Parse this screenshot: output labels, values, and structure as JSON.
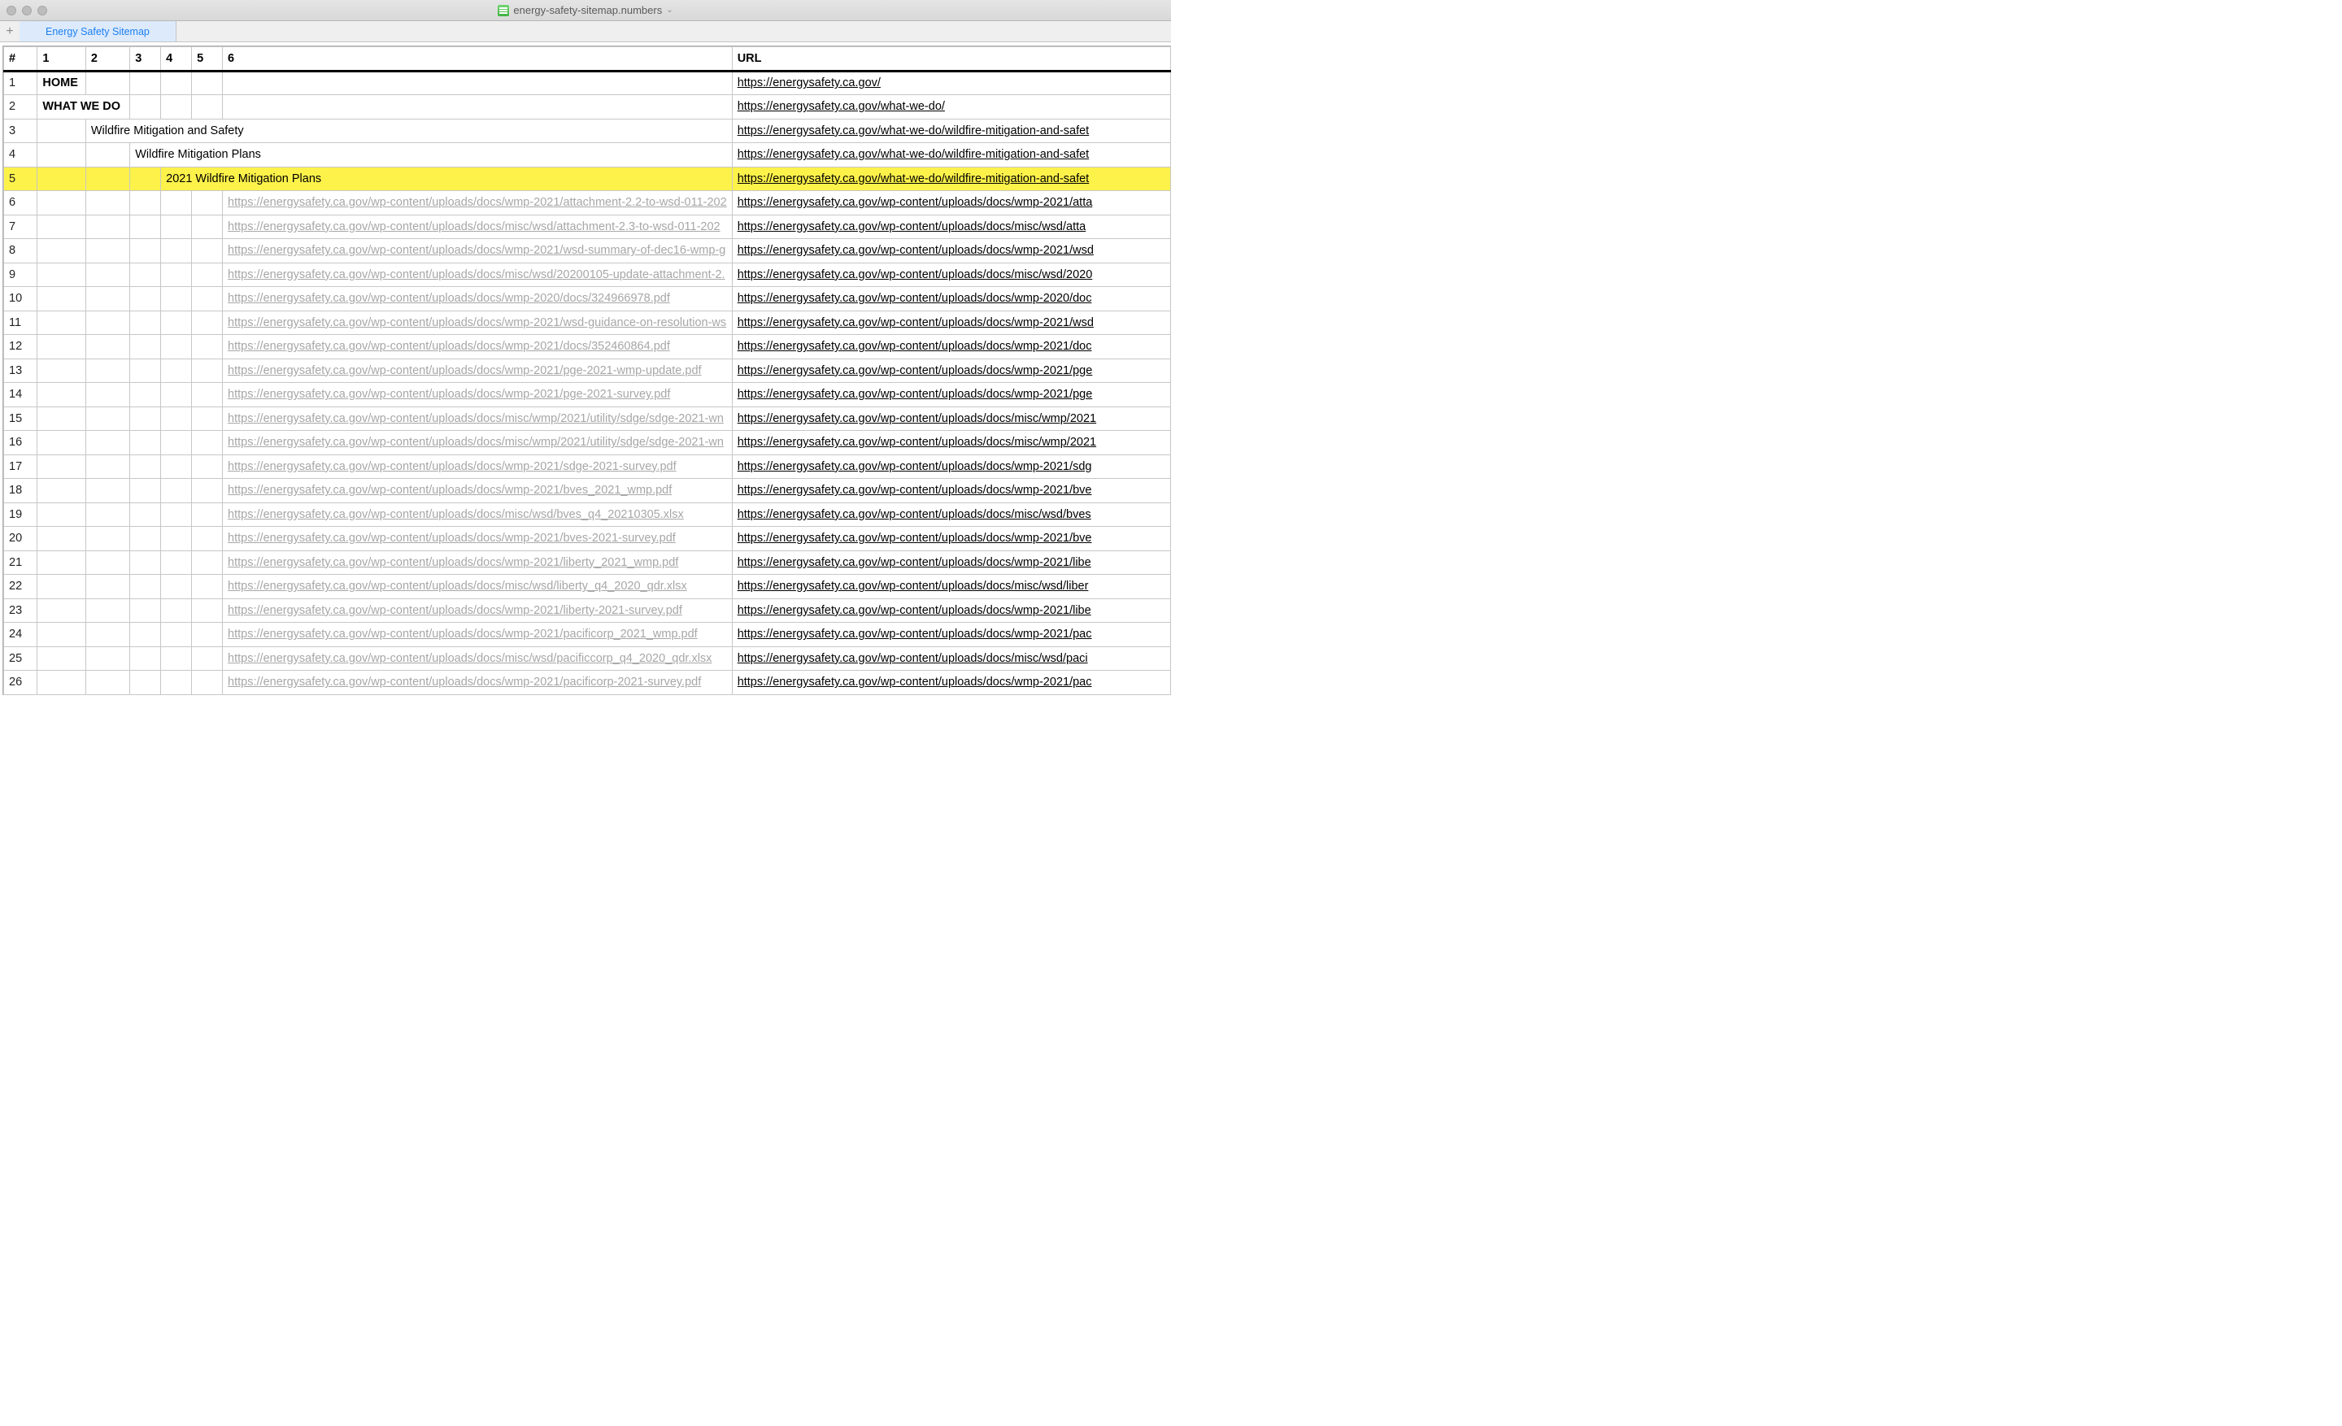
{
  "window": {
    "filename": "energy-safety-sitemap.numbers"
  },
  "tabs": {
    "add": "+",
    "sheet": "Energy Safety Sitemap"
  },
  "headers": [
    "#",
    "1",
    "2",
    "3",
    "4",
    "5",
    "6",
    "URL"
  ],
  "rows": [
    {
      "n": "1",
      "c1": "HOME",
      "c2": "",
      "c3": "",
      "c4": "",
      "c5": "",
      "c6": "",
      "url": "https://energysafety.ca.gov/",
      "bold": true,
      "c6link": false
    },
    {
      "n": "2",
      "c1": "WHAT WE DO",
      "c2": "",
      "c3": "",
      "c4": "",
      "c5": "",
      "c6": "",
      "url": "https://energysafety.ca.gov/what-we-do/",
      "bold": true,
      "c1colspan": 2,
      "c6link": false
    },
    {
      "n": "3",
      "c1": "",
      "c2": "Wildfire Mitigation and Safety",
      "c3": "",
      "c4": "",
      "c5": "",
      "c6": "",
      "url": "https://energysafety.ca.gov/what-we-do/wildfire-mitigation-and-safet",
      "c2colspan": 5,
      "c6link": false
    },
    {
      "n": "4",
      "c1": "",
      "c2": "",
      "c3": "Wildfire Mitigation Plans",
      "c4": "",
      "c5": "",
      "c6": "",
      "url": "https://energysafety.ca.gov/what-we-do/wildfire-mitigation-and-safet",
      "c3colspan": 4,
      "c6link": false
    },
    {
      "n": "5",
      "c1": "",
      "c2": "",
      "c3": "",
      "c4": "2021 Wildfire Mitigation Plans",
      "c5": "",
      "c6": "",
      "url": "https://energysafety.ca.gov/what-we-do/wildfire-mitigation-and-safet",
      "highlight": true,
      "c4colspan": 3,
      "c6link": false
    },
    {
      "n": "6",
      "c1": "",
      "c2": "",
      "c3": "",
      "c4": "",
      "c5": "",
      "c6": "https://energysafety.ca.gov/wp-content/uploads/docs/wmp-2021/attachment-2.2-to-wsd-011-202",
      "url": "https://energysafety.ca.gov/wp-content/uploads/docs/wmp-2021/atta",
      "c6link": true
    },
    {
      "n": "7",
      "c1": "",
      "c2": "",
      "c3": "",
      "c4": "",
      "c5": "",
      "c6": "https://energysafety.ca.gov/wp-content/uploads/docs/misc/wsd/attachment-2.3-to-wsd-011-202",
      "url": "https://energysafety.ca.gov/wp-content/uploads/docs/misc/wsd/atta",
      "c6link": true
    },
    {
      "n": "8",
      "c1": "",
      "c2": "",
      "c3": "",
      "c4": "",
      "c5": "",
      "c6": "https://energysafety.ca.gov/wp-content/uploads/docs/wmp-2021/wsd-summary-of-dec16-wmp-g",
      "url": "https://energysafety.ca.gov/wp-content/uploads/docs/wmp-2021/wsd",
      "c6link": true
    },
    {
      "n": "9",
      "c1": "",
      "c2": "",
      "c3": "",
      "c4": "",
      "c5": "",
      "c6": "https://energysafety.ca.gov/wp-content/uploads/docs/misc/wsd/20200105-update-attachment-2.",
      "url": "https://energysafety.ca.gov/wp-content/uploads/docs/misc/wsd/2020",
      "c6link": true
    },
    {
      "n": "10",
      "c1": "",
      "c2": "",
      "c3": "",
      "c4": "",
      "c5": "",
      "c6": "https://energysafety.ca.gov/wp-content/uploads/docs/wmp-2020/docs/324966978.pdf",
      "url": "https://energysafety.ca.gov/wp-content/uploads/docs/wmp-2020/doc",
      "c6link": true
    },
    {
      "n": "11",
      "c1": "",
      "c2": "",
      "c3": "",
      "c4": "",
      "c5": "",
      "c6": "https://energysafety.ca.gov/wp-content/uploads/docs/wmp-2021/wsd-guidance-on-resolution-ws",
      "url": "https://energysafety.ca.gov/wp-content/uploads/docs/wmp-2021/wsd",
      "c6link": true
    },
    {
      "n": "12",
      "c1": "",
      "c2": "",
      "c3": "",
      "c4": "",
      "c5": "",
      "c6": "https://energysafety.ca.gov/wp-content/uploads/docs/wmp-2021/docs/352460864.pdf",
      "url": "https://energysafety.ca.gov/wp-content/uploads/docs/wmp-2021/doc",
      "c6link": true
    },
    {
      "n": "13",
      "c1": "",
      "c2": "",
      "c3": "",
      "c4": "",
      "c5": "",
      "c6": "https://energysafety.ca.gov/wp-content/uploads/docs/wmp-2021/pge-2021-wmp-update.pdf",
      "url": "https://energysafety.ca.gov/wp-content/uploads/docs/wmp-2021/pge",
      "c6link": true
    },
    {
      "n": "14",
      "c1": "",
      "c2": "",
      "c3": "",
      "c4": "",
      "c5": "",
      "c6": "https://energysafety.ca.gov/wp-content/uploads/docs/wmp-2021/pge-2021-survey.pdf",
      "url": "https://energysafety.ca.gov/wp-content/uploads/docs/wmp-2021/pge",
      "c6link": true
    },
    {
      "n": "15",
      "c1": "",
      "c2": "",
      "c3": "",
      "c4": "",
      "c5": "",
      "c6": "https://energysafety.ca.gov/wp-content/uploads/docs/misc/wmp/2021/utility/sdge/sdge-2021-wn",
      "url": "https://energysafety.ca.gov/wp-content/uploads/docs/misc/wmp/2021",
      "c6link": true
    },
    {
      "n": "16",
      "c1": "",
      "c2": "",
      "c3": "",
      "c4": "",
      "c5": "",
      "c6": "https://energysafety.ca.gov/wp-content/uploads/docs/misc/wmp/2021/utility/sdge/sdge-2021-wn",
      "url": "https://energysafety.ca.gov/wp-content/uploads/docs/misc/wmp/2021",
      "c6link": true
    },
    {
      "n": "17",
      "c1": "",
      "c2": "",
      "c3": "",
      "c4": "",
      "c5": "",
      "c6": "https://energysafety.ca.gov/wp-content/uploads/docs/wmp-2021/sdge-2021-survey.pdf",
      "url": "https://energysafety.ca.gov/wp-content/uploads/docs/wmp-2021/sdg",
      "c6link": true
    },
    {
      "n": "18",
      "c1": "",
      "c2": "",
      "c3": "",
      "c4": "",
      "c5": "",
      "c6": "https://energysafety.ca.gov/wp-content/uploads/docs/wmp-2021/bves_2021_wmp.pdf",
      "url": "https://energysafety.ca.gov/wp-content/uploads/docs/wmp-2021/bve",
      "c6link": true
    },
    {
      "n": "19",
      "c1": "",
      "c2": "",
      "c3": "",
      "c4": "",
      "c5": "",
      "c6": "https://energysafety.ca.gov/wp-content/uploads/docs/misc/wsd/bves_q4_20210305.xlsx",
      "url": "https://energysafety.ca.gov/wp-content/uploads/docs/misc/wsd/bves",
      "c6link": true
    },
    {
      "n": "20",
      "c1": "",
      "c2": "",
      "c3": "",
      "c4": "",
      "c5": "",
      "c6": "https://energysafety.ca.gov/wp-content/uploads/docs/wmp-2021/bves-2021-survey.pdf",
      "url": "https://energysafety.ca.gov/wp-content/uploads/docs/wmp-2021/bve",
      "c6link": true
    },
    {
      "n": "21",
      "c1": "",
      "c2": "",
      "c3": "",
      "c4": "",
      "c5": "",
      "c6": "https://energysafety.ca.gov/wp-content/uploads/docs/wmp-2021/liberty_2021_wmp.pdf",
      "url": "https://energysafety.ca.gov/wp-content/uploads/docs/wmp-2021/libe",
      "c6link": true
    },
    {
      "n": "22",
      "c1": "",
      "c2": "",
      "c3": "",
      "c4": "",
      "c5": "",
      "c6": "https://energysafety.ca.gov/wp-content/uploads/docs/misc/wsd/liberty_q4_2020_qdr.xlsx",
      "url": "https://energysafety.ca.gov/wp-content/uploads/docs/misc/wsd/liber",
      "c6link": true
    },
    {
      "n": "23",
      "c1": "",
      "c2": "",
      "c3": "",
      "c4": "",
      "c5": "",
      "c6": "https://energysafety.ca.gov/wp-content/uploads/docs/wmp-2021/liberty-2021-survey.pdf",
      "url": "https://energysafety.ca.gov/wp-content/uploads/docs/wmp-2021/libe",
      "c6link": true
    },
    {
      "n": "24",
      "c1": "",
      "c2": "",
      "c3": "",
      "c4": "",
      "c5": "",
      "c6": "https://energysafety.ca.gov/wp-content/uploads/docs/wmp-2021/pacificorp_2021_wmp.pdf",
      "url": "https://energysafety.ca.gov/wp-content/uploads/docs/wmp-2021/pac",
      "c6link": true
    },
    {
      "n": "25",
      "c1": "",
      "c2": "",
      "c3": "",
      "c4": "",
      "c5": "",
      "c6": "https://energysafety.ca.gov/wp-content/uploads/docs/misc/wsd/pacificcorp_q4_2020_qdr.xlsx",
      "url": "https://energysafety.ca.gov/wp-content/uploads/docs/misc/wsd/paci",
      "c6link": true
    },
    {
      "n": "26",
      "c1": "",
      "c2": "",
      "c3": "",
      "c4": "",
      "c5": "",
      "c6": "https://energysafety.ca.gov/wp-content/uploads/docs/wmp-2021/pacificorp-2021-survey.pdf",
      "url": "https://energysafety.ca.gov/wp-content/uploads/docs/wmp-2021/pac",
      "c6link": true
    }
  ]
}
